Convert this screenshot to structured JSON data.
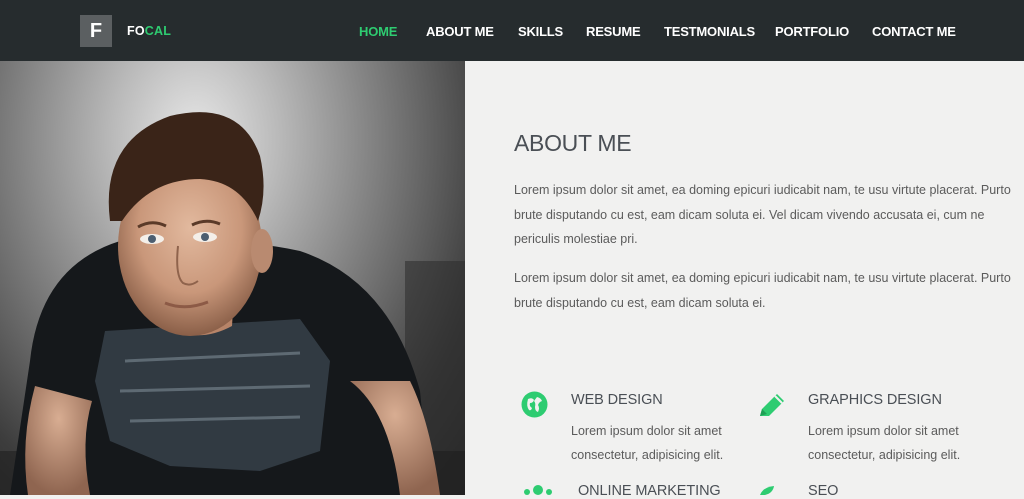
{
  "brand": {
    "letter": "F",
    "name_part1": "FO",
    "name_part2": "CAL"
  },
  "nav": {
    "items": [
      {
        "label": "HOME",
        "active": true
      },
      {
        "label": "ABOUT ME",
        "active": false
      },
      {
        "label": "SKILLS",
        "active": false
      },
      {
        "label": "RESUME",
        "active": false
      },
      {
        "label": "TESTMONIALS",
        "active": false
      },
      {
        "label": "PORTFOLIO",
        "active": false
      },
      {
        "label": "CONTACT ME",
        "active": false
      }
    ]
  },
  "about": {
    "title": "ABOUT ME",
    "paragraphs": [
      "Lorem ipsum dolor sit amet, ea doming epicuri iudicabit nam, te usu virtute placerat. Purto brute disputando cu est, eam dicam soluta ei. Vel dicam vivendo accusata ei, cum ne periculis molestiae pri.",
      "Lorem ipsum dolor sit amet, ea doming epicuri iudicabit nam, te usu virtute placerat. Purto brute disputando cu est, eam dicam soluta ei."
    ]
  },
  "services": [
    {
      "icon": "globe-icon",
      "title": "WEB DESIGN",
      "desc": "Lorem ipsum dolor sit amet consectetur, adipisicing elit."
    },
    {
      "icon": "pencil-icon",
      "title": "GRAPHICS DESIGN",
      "desc": "Lorem ipsum dolor sit amet consectetur, adipisicing elit."
    },
    {
      "icon": "share-icon",
      "title": "ONLINE MARKETING",
      "desc": ""
    },
    {
      "icon": "leaf-icon",
      "title": "SEO",
      "desc": ""
    }
  ],
  "colors": {
    "accent": "#2ecc71",
    "nav_bg": "#262c2e",
    "panel_bg": "#f1f1f0",
    "heading": "#4a4f55",
    "text": "#5b5b5b"
  }
}
